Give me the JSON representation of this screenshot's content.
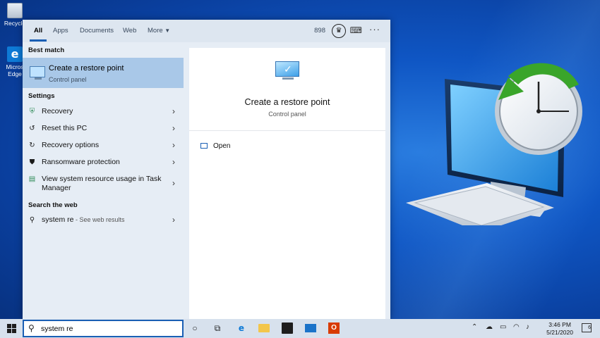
{
  "desktop": {
    "recycle_label": "Recycle",
    "edge_label_1": "Micros",
    "edge_label_2": "Edge"
  },
  "search_panel": {
    "tabs": [
      {
        "label": "All"
      },
      {
        "label": "Apps"
      },
      {
        "label": "Documents"
      },
      {
        "label": "Web"
      },
      {
        "label": "More"
      }
    ],
    "reward_points": "898",
    "best_match_heading": "Best match",
    "best_match": {
      "title": "Create a restore point",
      "subtitle": "Control panel"
    },
    "settings_heading": "Settings",
    "settings_items": [
      {
        "label": "Recovery"
      },
      {
        "label": "Reset this PC"
      },
      {
        "label": "Recovery options"
      },
      {
        "label": "Ransomware protection"
      },
      {
        "label": "View system resource usage in Task Manager"
      }
    ],
    "web_heading": "Search the web",
    "web_item": {
      "query": "system re",
      "suffix": " - See web results"
    },
    "preview": {
      "title": "Create a restore point",
      "subtitle": "Control panel",
      "open_label": "Open"
    }
  },
  "taskbar": {
    "search_value": "system re",
    "time": "3:46 PM",
    "date": "5/21/2020",
    "notification_count": "6"
  },
  "colors": {
    "accent": "#1a5fb4",
    "selected_row": "#a9c8e8",
    "panel_bg": "#e6edf5",
    "desktop_blue": "#0f56c4"
  }
}
